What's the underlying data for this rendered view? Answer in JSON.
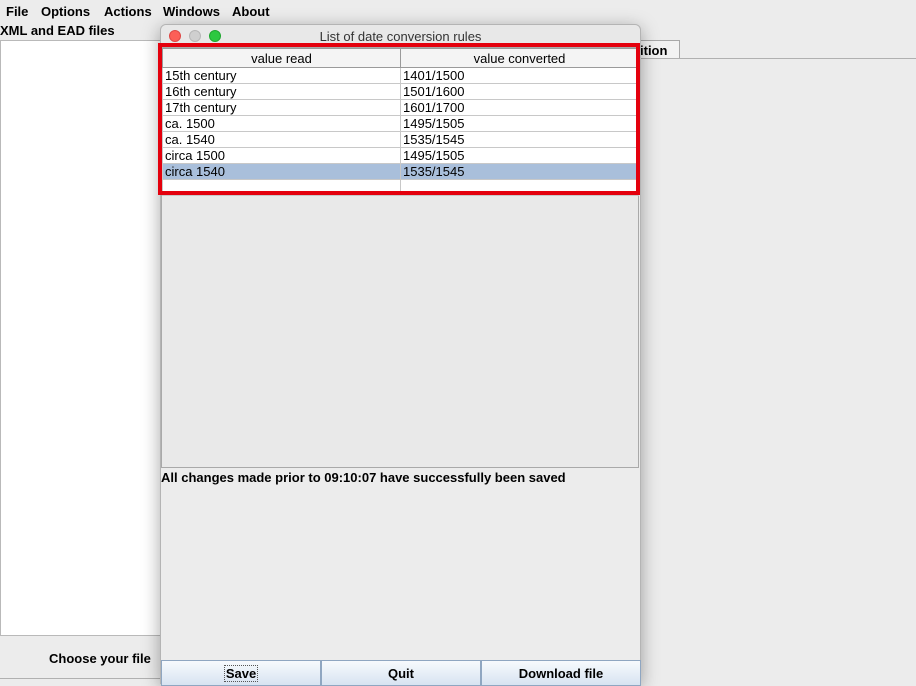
{
  "menu": {
    "items": [
      "File",
      "Options",
      "Actions",
      "Windows",
      "About"
    ]
  },
  "main_window": {
    "files_panel_title": "XML and EAD files",
    "choose_file_label": "Choose your file",
    "edition_tab_label": "ition"
  },
  "dialog": {
    "title": "List of date conversion rules",
    "table": {
      "columns": [
        "value read",
        "value converted"
      ],
      "rows": [
        {
          "read": "15th century",
          "converted": "1401/1500"
        },
        {
          "read": "16th century",
          "converted": "1501/1600"
        },
        {
          "read": "17th century",
          "converted": "1601/1700"
        },
        {
          "read": "ca. 1500",
          "converted": "1495/1505"
        },
        {
          "read": "ca. 1540",
          "converted": "1535/1545"
        },
        {
          "read": "circa 1500",
          "converted": "1495/1505"
        },
        {
          "read": "circa 1540",
          "converted": "1535/1545"
        },
        {
          "read": "",
          "converted": ""
        }
      ],
      "selected_row_index": 6
    },
    "status": "All changes made prior to 09:10:07 have successfully been saved",
    "buttons": {
      "save": "Save",
      "quit": "Quit",
      "download": "Download file"
    }
  },
  "colors": {
    "highlight_outline": "#e4000d",
    "selected_row": "#a9bfdb",
    "close_button": "#fc5f57",
    "maximize_button": "#2dc840"
  }
}
